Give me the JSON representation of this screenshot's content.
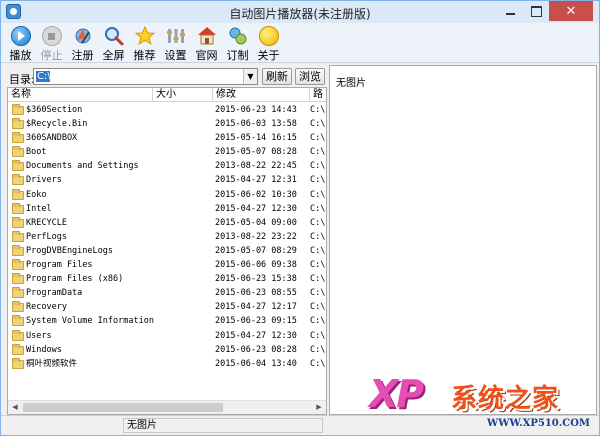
{
  "window": {
    "title": "自动图片播放器(未注册版)",
    "close_glyph": "✕"
  },
  "toolbar": {
    "items": [
      {
        "label": "播放",
        "icon": "play-icon",
        "enabled": true
      },
      {
        "label": "停止",
        "icon": "stop-icon",
        "enabled": false
      },
      {
        "label": "注册",
        "icon": "register-icon",
        "enabled": true
      },
      {
        "label": "全屏",
        "icon": "fullscreen-icon",
        "enabled": true
      },
      {
        "label": "推荐",
        "icon": "recommend-icon",
        "enabled": true
      },
      {
        "label": "设置",
        "icon": "settings-icon",
        "enabled": true
      },
      {
        "label": "官网",
        "icon": "home-icon",
        "enabled": true
      },
      {
        "label": "订制",
        "icon": "order-icon",
        "enabled": true
      },
      {
        "label": "关于",
        "icon": "about-icon",
        "enabled": true
      }
    ]
  },
  "directory": {
    "label": "目录:",
    "value": "C:\\",
    "refresh_label": "刷新",
    "browse_label": "浏览"
  },
  "file_list": {
    "columns": {
      "name": "名称",
      "size": "大小",
      "modified": "修改",
      "path": "路"
    },
    "rows": [
      {
        "name": "$360Section",
        "modified": "2015-06-23 14:43",
        "path": "C:\\"
      },
      {
        "name": "$Recycle.Bin",
        "modified": "2015-06-03 13:58",
        "path": "C:\\"
      },
      {
        "name": "360SANDBOX",
        "modified": "2015-05-14 16:15",
        "path": "C:\\"
      },
      {
        "name": "Boot",
        "modified": "2015-05-07 08:28",
        "path": "C:\\"
      },
      {
        "name": "Documents and Settings",
        "modified": "2013-08-22 22:45",
        "path": "C:\\"
      },
      {
        "name": "Drivers",
        "modified": "2015-04-27 12:31",
        "path": "C:\\"
      },
      {
        "name": "Eoko",
        "modified": "2015-06-02 10:30",
        "path": "C:\\"
      },
      {
        "name": "Intel",
        "modified": "2015-04-27 12:30",
        "path": "C:\\"
      },
      {
        "name": "KRECYCLE",
        "modified": "2015-05-04 09:00",
        "path": "C:\\"
      },
      {
        "name": "PerfLogs",
        "modified": "2013-08-22 23:22",
        "path": "C:\\"
      },
      {
        "name": "ProgDVBEngineLogs",
        "modified": "2015-05-07 08:29",
        "path": "C:\\"
      },
      {
        "name": "Program Files",
        "modified": "2015-06-06 09:38",
        "path": "C:\\"
      },
      {
        "name": "Program Files (x86)",
        "modified": "2015-06-23 15:38",
        "path": "C:\\"
      },
      {
        "name": "ProgramData",
        "modified": "2015-06-23 08:55",
        "path": "C:\\"
      },
      {
        "name": "Recovery",
        "modified": "2015-04-27 12:17",
        "path": "C:\\"
      },
      {
        "name": "System Volume Information",
        "modified": "2015-06-23 09:15",
        "path": "C:\\"
      },
      {
        "name": "Users",
        "modified": "2015-04-27 12:30",
        "path": "C:\\"
      },
      {
        "name": "Windows",
        "modified": "2015-06-23 08:28",
        "path": "C:\\"
      },
      {
        "name": "桐叶视频软件",
        "modified": "2015-06-04 13:40",
        "path": "C:\\"
      }
    ]
  },
  "preview": {
    "placeholder": "无图片"
  },
  "statusbar": {
    "text": "无图片"
  },
  "watermark": {
    "logo": "XP",
    "title": "系统之家",
    "url": "WWW.XP510.COM"
  }
}
